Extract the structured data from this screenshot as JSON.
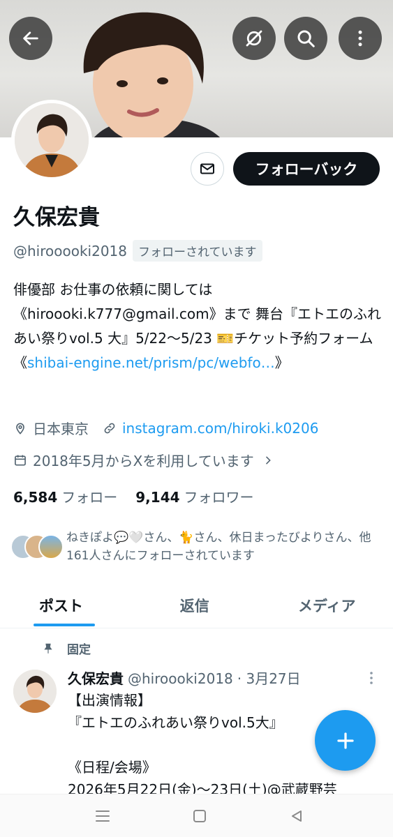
{
  "header": {
    "back_icon": "arrow-left-icon",
    "rate_icon": "no-tint-icon",
    "search_icon": "search-icon",
    "more_icon": "more-vertical-icon"
  },
  "profile": {
    "name": "久保宏貴",
    "handle": "@hirooooki2018",
    "follows_you": "フォローされています",
    "follow_back_label": "フォローバック",
    "bio_prefix": "俳優部 お仕事の依頼に関しては《hiroooki.k777@gmail.com》まで 舞台『エトエのふれあい祭りvol.5 大』5/22〜5/23 🎫チケット予約フォーム 《",
    "bio_link": "shibai-engine.net/prism/pc/webfo…",
    "bio_suffix": "》",
    "location": "日本東京",
    "website": "instagram.com/hiroki.k0206",
    "joined": "2018年5月からXを利用しています",
    "following_count": "6,584",
    "following_label": "フォロー",
    "followers_count": "9,144",
    "followers_label": "フォロワー",
    "followed_by_text": "ねきぽよ💬🤍さん、🐈さん、休日まったびよりさん、他161人さんにフォローされています"
  },
  "tabs": [
    {
      "label": "ポスト",
      "active": true
    },
    {
      "label": "返信",
      "active": false
    },
    {
      "label": "メディア",
      "active": false
    }
  ],
  "pinned_post": {
    "pinned_label": "固定",
    "author": "久保宏貴",
    "handle": "@hiroooki2018",
    "date": "· 3月27日",
    "body": "【出演情報】\n『エトエのふれあい祭りvol.5大』\n\n《日程/会場》\n2026年5月22日(金)〜23日(土)@武蔵野芸"
  },
  "colors": {
    "accent": "#1d9bf0",
    "text": "#0f1419",
    "muted": "#536471"
  }
}
